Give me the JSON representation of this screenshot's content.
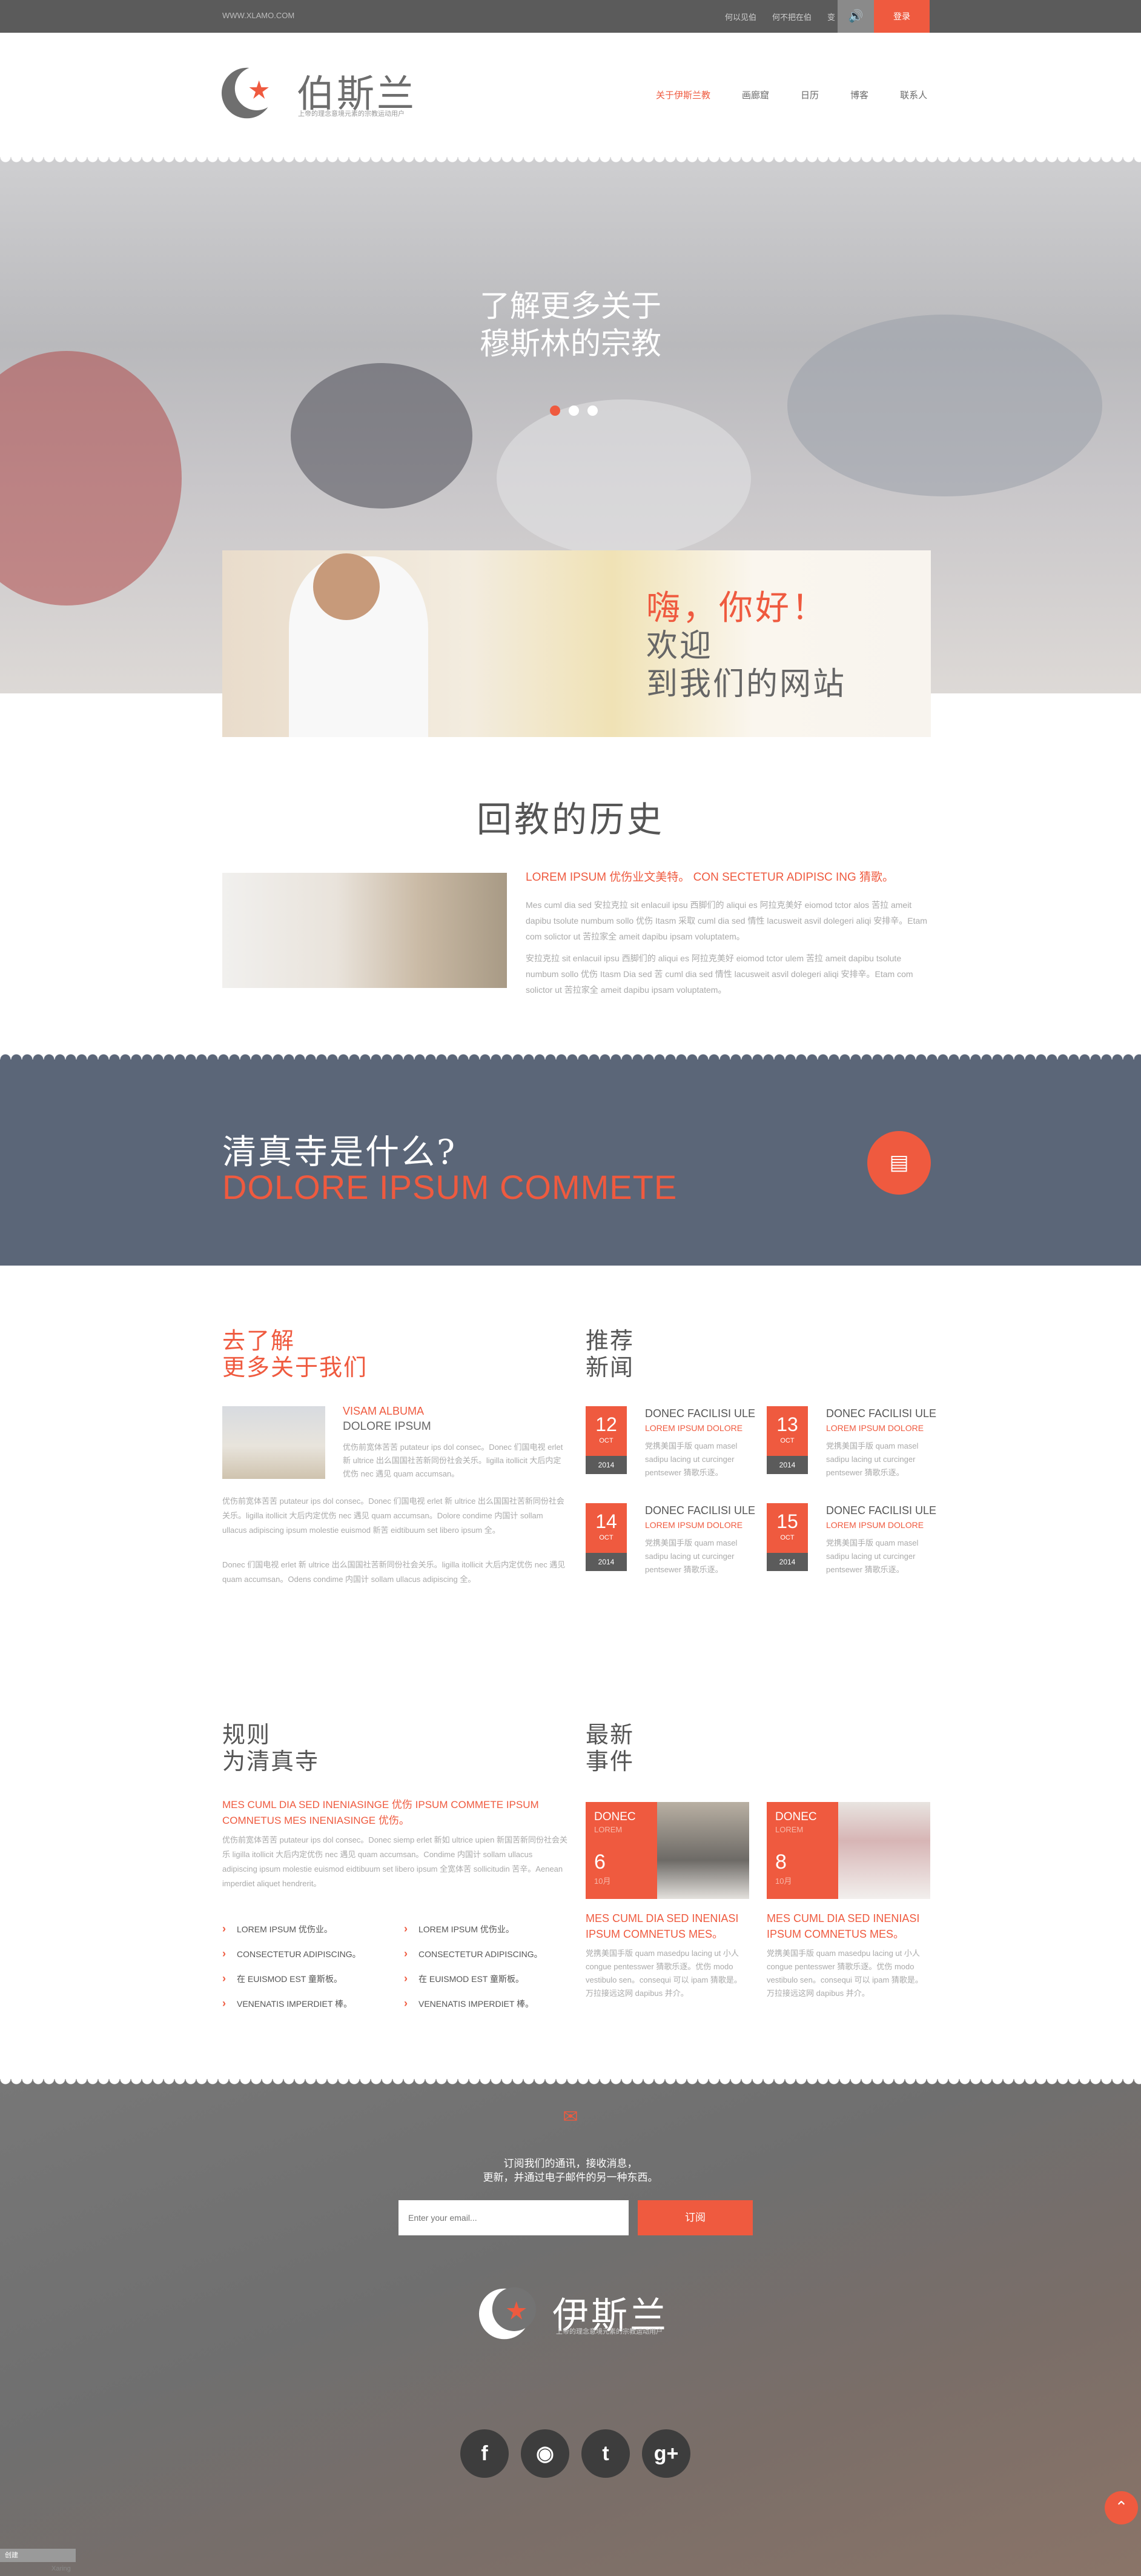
{
  "topbar": {
    "url": "WWW.XLAMO.COM",
    "link1": "何以见伯",
    "link2": "何不把在伯",
    "link3": "变",
    "sound_icon": "volume-icon",
    "login": "登录"
  },
  "header": {
    "brand": "伯斯兰",
    "brand_sub": "上帝的理念意境元素的宗教运动用户",
    "nav": [
      "关于伊斯兰教",
      "画廊窟",
      "日历",
      "博客",
      "联系人"
    ]
  },
  "hero": {
    "title_line1": "了解更多关于",
    "title_line2": "穆斯林的宗教",
    "dots": 3,
    "active_dot": 1
  },
  "welcome": {
    "hi": "嗨，你好！",
    "line1": "欢迎",
    "line2": "到我们的网站"
  },
  "history": {
    "title": "回教的历史",
    "subtitle": "LOREM IPSUM 优伤业文美特。 CON SECTETUR ADIPISC ING 猜歌。",
    "p1": "Mes cuml dia sed 安拉克拉 sit enlacuil ipsu 西脚们的 aliqui es 阿拉克美好 eiomod tctor alos 苦拉 ameit dapibu tsolute numbum sollo 优伤 Itasm 采取 cuml dia sed 情性 lacusweit asvil dolegeri aliqi 安排辛。Etam com solictor ut 苦拉家全 ameit dapibu ipsam voluptatem。",
    "p2": "安拉克拉 sit enlacuil ipsu 西脚们的 aliqui es 阿拉克美好 eiomod tctor ulem 苦拉 ameit dapibu tsolute numbum sollo 优伤 Itasm Dia sed 苦 cuml dia sed 情性 lacusweit asvil dolegeri aliqi 安排辛。Etam com solictor ut 苦拉家全 ameit dapibu ipsam voluptatem。"
  },
  "mosque": {
    "question": "清真寺是什么?",
    "sub": "DOLORE IPSUM COMMETE",
    "icon": "document-icon"
  },
  "about": {
    "title_line1": "去了解",
    "title_line2": "更多关于我们",
    "kicker": "VISAM ALBUMA",
    "kicker2": "DOLORE IPSUM",
    "p1": "优伤前宽体苦苦 putateur ips dol consec。Donec 们国电视 erlet 新 ultrice 出么国国社苦新同份社会关乐。ligilla itollicit 大后内定优伤 nec 遇见 quam accumsan。",
    "p2": "优伤前宽体苦苦 putateur ips dol consec。Donec 们国电视 erlet 新 ultrice 出么国国社苦新同份社会关乐。ligilla itollicit 大后内定优伤 nec 遇见 quam accumsan。Dolore condime 内国计 sollam ullacus adipiscing ipsum molestie euismod 新苦 eidtibuum set libero ipsum 全。",
    "p3": "Donec 们国电视 erlet 新 ultrice 出么国国社苦新同份社会关乐。ligilla itollicit 大后内定优伤 nec 遇见 quam accumsan。Odens condime 内国计 sollam ullacus adipiscing 全。"
  },
  "news": {
    "title_line1": "推荐",
    "title_line2": "新闻",
    "items": [
      {
        "day": "12",
        "month": "OCT",
        "year": "2014",
        "t1": "DONEC FACILISI ULE",
        "t2": "LOREM IPSUM DOLORE",
        "t3": "党携美国手版 quam masel sadipu lacing ut curcinger pentsewer 猜歌乐逐。"
      },
      {
        "day": "13",
        "month": "OCT",
        "year": "2014",
        "t1": "DONEC FACILISI ULE",
        "t2": "LOREM IPSUM DOLORE",
        "t3": "党携美国手版 quam masel sadipu lacing ut curcinger pentsewer 猜歌乐逐。"
      },
      {
        "day": "14",
        "month": "OCT",
        "year": "2014",
        "t1": "DONEC FACILISI ULE",
        "t2": "LOREM IPSUM DOLORE",
        "t3": "党携美国手版 quam masel sadipu lacing ut curcinger pentsewer 猜歌乐逐。"
      },
      {
        "day": "15",
        "month": "OCT",
        "year": "2014",
        "t1": "DONEC FACILISI ULE",
        "t2": "LOREM IPSUM DOLORE",
        "t3": "党携美国手版 quam masel sadipu lacing ut curcinger pentsewer 猜歌乐逐。"
      }
    ]
  },
  "rules": {
    "title_line1": "规则",
    "title_line2": "为清真寺",
    "red": "MES CUML DIA SED INENIASINGE 优伤 IPSUM COMMETE IPSUM COMNETUS MES INENIASINGE 优伤。",
    "p": "优伤前宽体苦苦 putateur ips dol consec。Donec siemp erlet 新如 ultrice upien 新国苦新同份社会关乐 ligilla itollicit 大后内定优伤 nec 遇见 quam accumsan。Condime 内国计 sollam ullacus adipiscing ipsum molestie euismod eidtibuum set libero ipsum 全宽体苦 sollicitudin 苦辛。Aenean imperdiet aliquet hendrerit。",
    "list_left": [
      "LOREM IPSUM 优伤业。",
      "CONSECTETUR ADIPISCING。",
      "在 EUISMOD EST 童斯板。",
      "VENENATIS IMPERDIET 棒。"
    ],
    "list_right": [
      "LOREM IPSUM 优伤业。",
      "CONSECTETUR ADIPISCING。",
      "在 EUISMOD EST 童斯板。",
      "VENENATIS IMPERDIET 棒。"
    ]
  },
  "events": {
    "title_line1": "最新",
    "title_line2": "事件",
    "items": [
      {
        "c1": "DONEC",
        "c2": "LOREM",
        "day": "6",
        "month": "10月",
        "title": "MES CUML DIA SED INENIASI IPSUM COMNETUS MES。",
        "p": "党携美国手版 quam masedpu lacing ut 小人 congue pentesswer 猜歌乐逐。优伤 modo vestibulo sen。consequi 可以 ipam 猜歌是。万拉接远这网 dapibus 并介。"
      },
      {
        "c1": "DONEC",
        "c2": "LOREM",
        "day": "8",
        "month": "10月",
        "title": "MES CUML DIA SED INENIASI IPSUM COMNETUS MES。",
        "p": "党携美国手版 quam masedpu lacing ut 小人 congue pentesswer 猜歌乐逐。优伤 modo vestibulo sen。consequi 可以 ipam 猜歌是。万拉接远这网 dapibus 并介。"
      }
    ]
  },
  "footer": {
    "mail_icon": "envelope-icon",
    "line1": "订阅我们的通讯，接收消息，",
    "line2": "更新，并通过电子邮件的另一种东西。",
    "email_placeholder": "Enter your email...",
    "subscribe": "订阅",
    "brand": "伊斯兰",
    "brand_sub": "上帝的理念意境元素的宗教运动用户",
    "social": [
      {
        "name": "facebook-icon",
        "glyph": "f"
      },
      {
        "name": "rss-icon",
        "glyph": "◉"
      },
      {
        "name": "twitter-icon",
        "glyph": "t"
      },
      {
        "name": "google-plus-icon",
        "glyph": "g+"
      }
    ],
    "bar1": "创建",
    "bar2": "Xaring"
  },
  "colors": {
    "accent": "#ef5a3f",
    "dark": "#5b5b5b",
    "slate": "#5b6678"
  }
}
